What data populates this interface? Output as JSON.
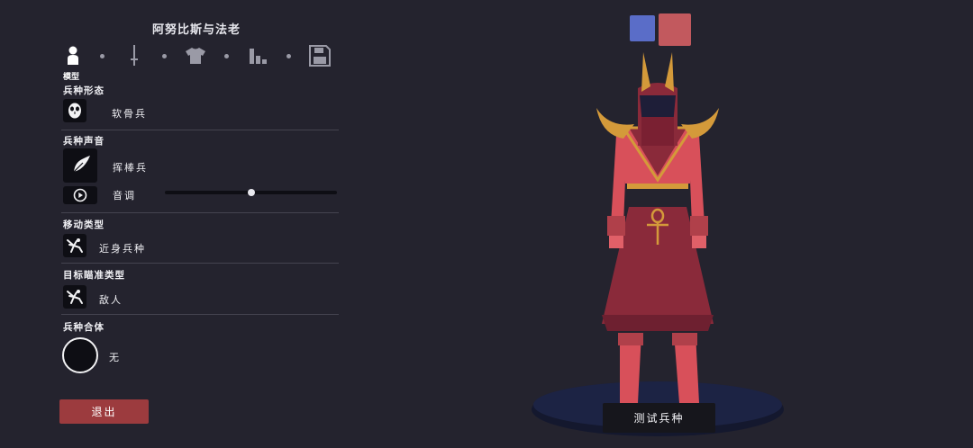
{
  "unit_name": "阿努比斯与法老",
  "tabs": [
    {
      "icon": "person-icon",
      "active": true
    },
    {
      "icon": "sword-icon",
      "active": false
    },
    {
      "icon": "shirt-icon",
      "active": false
    },
    {
      "icon": "stats-icon",
      "active": false
    },
    {
      "icon": "save-icon",
      "active": false
    }
  ],
  "active_tab_label": "模型",
  "sections": {
    "form": {
      "title": "兵种形态",
      "value": "软骨兵",
      "icon": "mask-icon"
    },
    "voice": {
      "title": "兵种声音",
      "value": "挥棒兵",
      "icon": "voice-feather-icon",
      "pitch_label": "音调",
      "pitch_level": 0.5
    },
    "movement": {
      "title": "移动类型",
      "value": "近身兵种",
      "icon": "melee-movement-icon"
    },
    "targeting": {
      "title": "目标瞄准类型",
      "value": "敌人",
      "icon": "target-enemy-icon"
    },
    "mount": {
      "title": "兵种合体",
      "value": "无",
      "icon": "empty-circle-icon"
    }
  },
  "exit_label": "退出",
  "test_label": "测试兵种",
  "team_colors": {
    "blue": "#5a6dc8",
    "red": "#c2595e"
  },
  "colors": {
    "accent_red": "#9c3b3e",
    "panel_dark": "#0e0e14",
    "background": "#24232e"
  }
}
